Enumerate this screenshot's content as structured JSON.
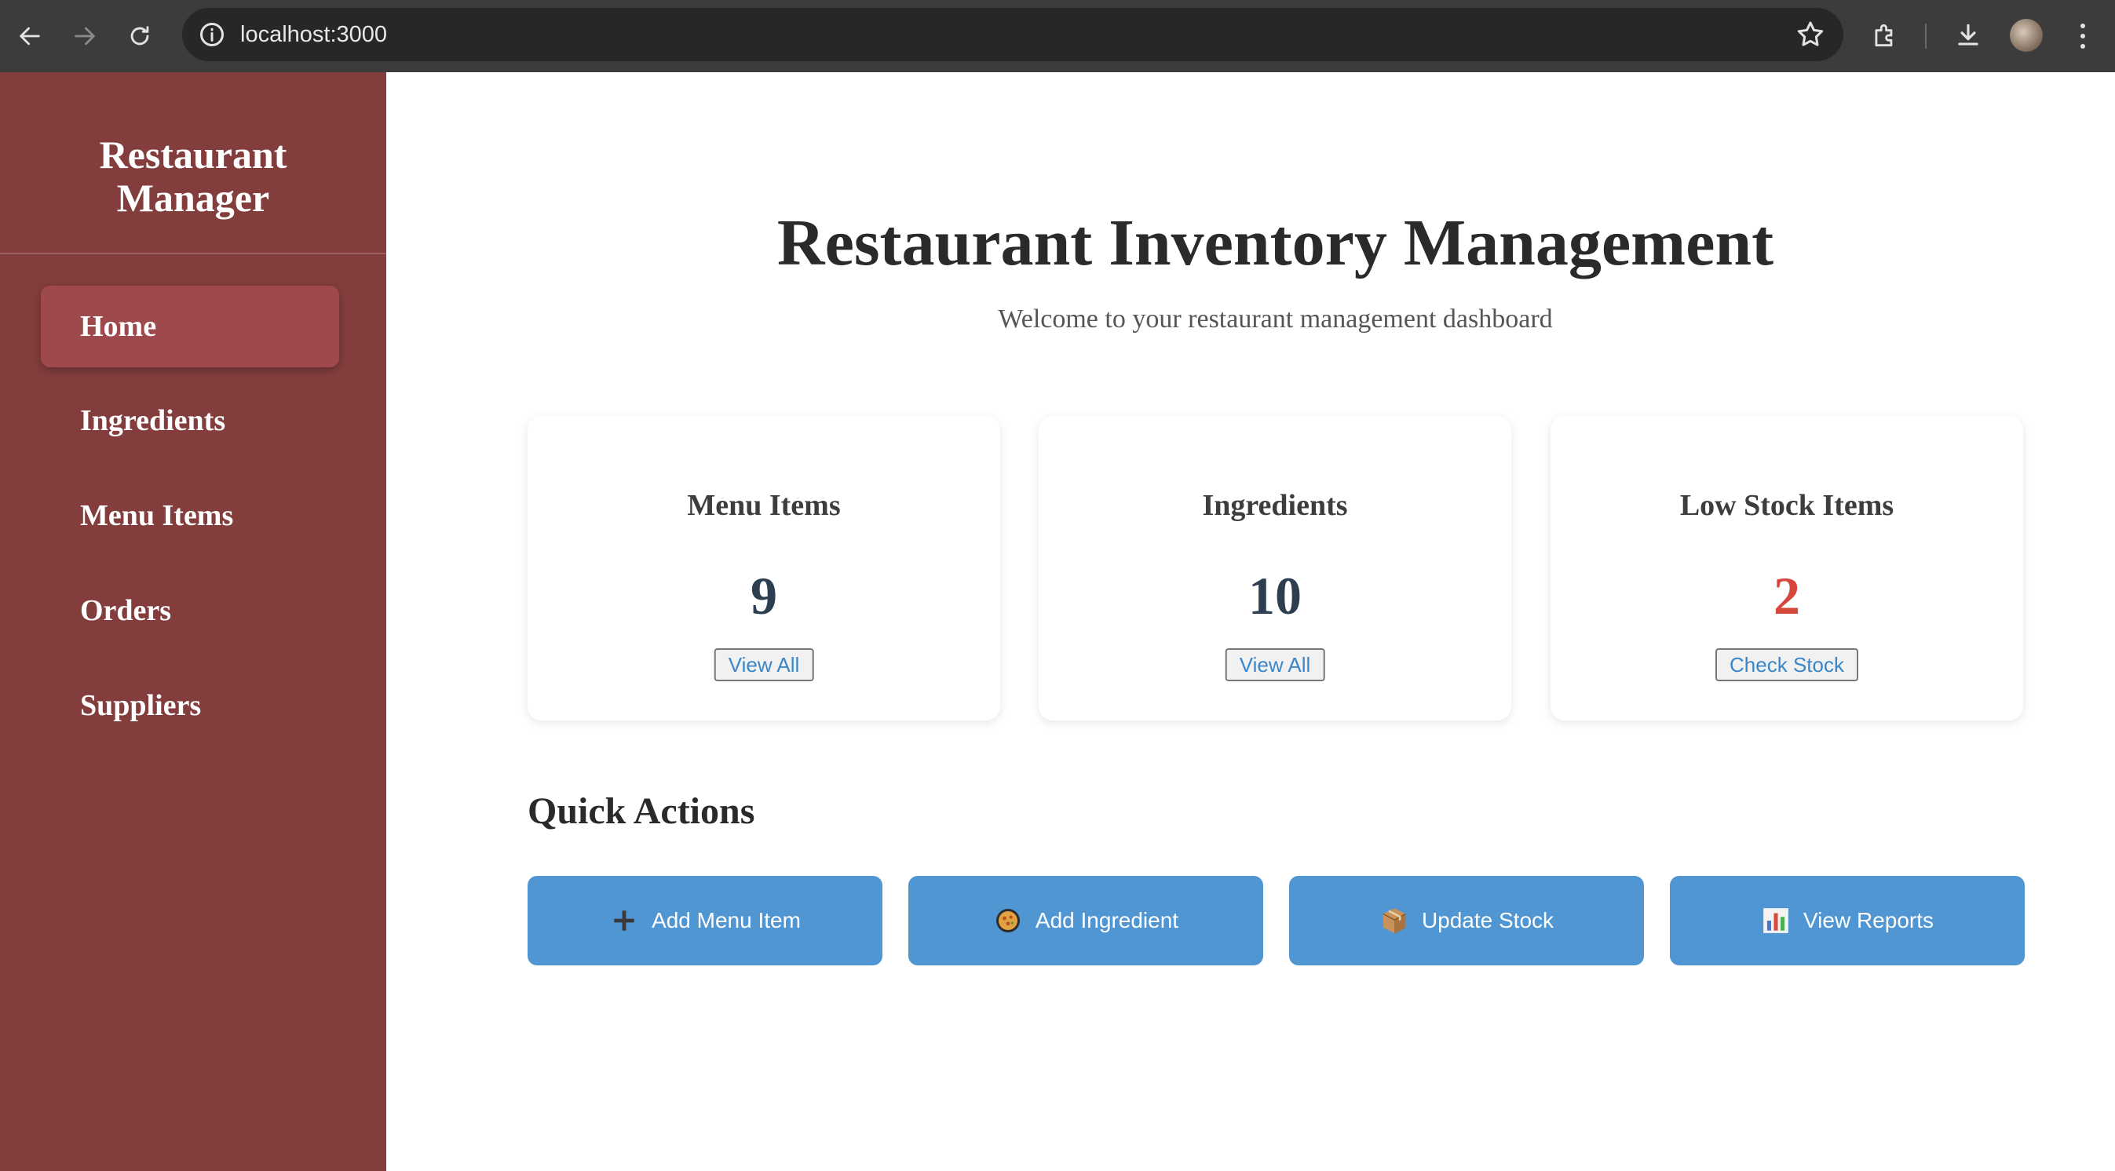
{
  "browser": {
    "url": "localhost:3000"
  },
  "sidebar": {
    "brand_line1": "Restaurant",
    "brand_line2": "Manager",
    "items": [
      {
        "label": "Home",
        "active": true
      },
      {
        "label": "Ingredients",
        "active": false
      },
      {
        "label": "Menu Items",
        "active": false
      },
      {
        "label": "Orders",
        "active": false
      },
      {
        "label": "Suppliers",
        "active": false
      }
    ]
  },
  "main": {
    "title": "Restaurant Inventory Management",
    "subtitle": "Welcome to your restaurant management dashboard",
    "cards": [
      {
        "title": "Menu Items",
        "value": "9",
        "button": "View All",
        "value_color": "#2c3e50"
      },
      {
        "title": "Ingredients",
        "value": "10",
        "button": "View All",
        "value_color": "#2c3e50"
      },
      {
        "title": "Low Stock Items",
        "value": "2",
        "button": "Check Stock",
        "value_color": "#d7483c"
      }
    ],
    "quick_actions_title": "Quick Actions",
    "actions": [
      {
        "label": "Add Menu Item",
        "icon": "plus-icon"
      },
      {
        "label": "Add Ingredient",
        "icon": "ingredient-icon"
      },
      {
        "label": "Update Stock",
        "icon": "package-icon"
      },
      {
        "label": "View Reports",
        "icon": "bar-chart-icon"
      }
    ]
  },
  "colors": {
    "sidebar_bg": "#833d3d",
    "sidebar_active": "#9e4a4d",
    "action_button": "#5096d3",
    "low_stock": "#d7483c"
  }
}
